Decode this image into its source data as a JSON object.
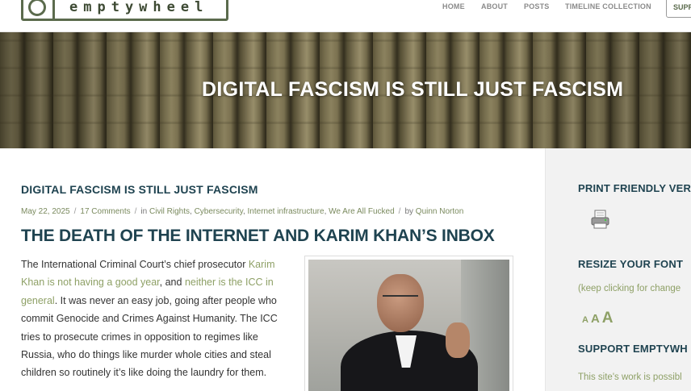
{
  "header": {
    "logo_text": "emptywheel",
    "nav": [
      "HOME",
      "ABOUT",
      "POSTS",
      "TIMELINE COLLECTION"
    ],
    "support_label": "SUPP"
  },
  "banner": {
    "title": "DIGITAL FASCISM IS STILL JUST FASCISM"
  },
  "post": {
    "title": "DIGITAL FASCISM IS STILL JUST FASCISM",
    "date": "May 22, 2025",
    "comments": "17 Comments",
    "in_label": "in",
    "categories": [
      "Civil Rights",
      "Cybersecurity",
      "Internet infrastructure",
      "We Are All Fucked"
    ],
    "by_label": "by",
    "author": "Quinn Norton",
    "headline": "THE DEATH OF THE INTERNET AND KARIM KHAN’S INBOX",
    "body": {
      "t1": "The International Criminal Court’s chief prosecutor ",
      "link1": "Karim Khan is not having a good year",
      "t2": ", and ",
      "link2": "neither is the ICC in general",
      "t3": ". It was never an easy job, going after people who commit Genocide and Crimes Against Humanity. The ICC tries to prosecute crimes in opposition to regimes like Russia, who do things like murder whole cities and steal children so routinely it’s like doing the laundry for them."
    }
  },
  "sidebar": {
    "print_heading": "PRINT FRIENDLY VER",
    "font_heading": "RESIZE YOUR FONT",
    "font_note": "(keep clicking for change",
    "font_sizes": [
      "A",
      "A",
      "A"
    ],
    "support_heading": "SUPPORT EMPTYWH",
    "support_text": "This site's work is possibl"
  },
  "colors": {
    "title_navy": "#1f4350",
    "link_green": "#8ea066",
    "logo_green": "#5b6b4d"
  }
}
